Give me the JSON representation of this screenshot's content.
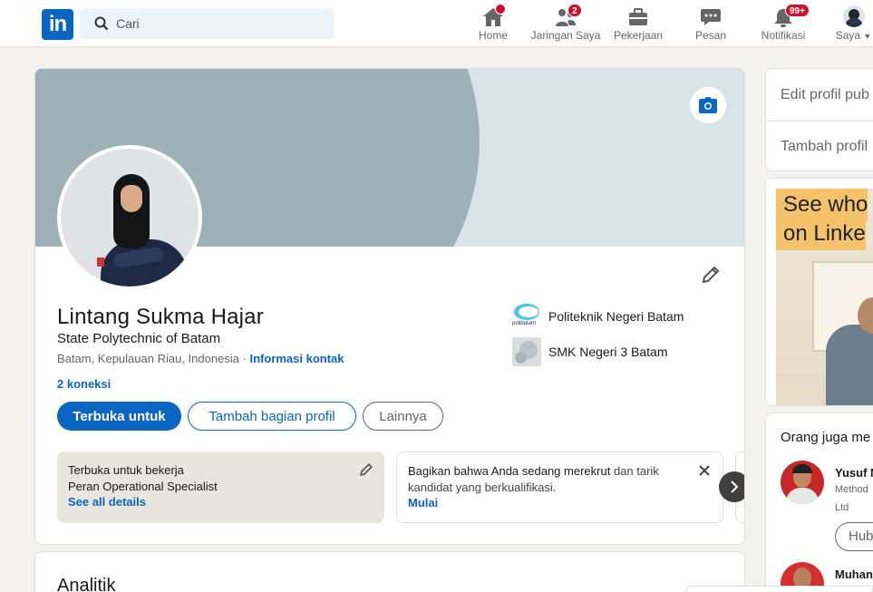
{
  "header": {
    "search_placeholder": "Cari",
    "nav": [
      {
        "label": "Home",
        "badge": ""
      },
      {
        "label": "Jaringan Saya",
        "badge": "2"
      },
      {
        "label": "Pekerjaan",
        "badge": ""
      },
      {
        "label": "Pesan",
        "badge": ""
      },
      {
        "label": "Notifikasi",
        "badge": "99+"
      },
      {
        "label": "Saya",
        "badge": ""
      }
    ]
  },
  "profile": {
    "name": "Lintang Sukma Hajar",
    "headline": "State Polytechnic of Batam",
    "location": "Batam, Kepulauan Riau, Indonesia · ",
    "contact_link": "Informasi kontak",
    "connections": "2 koneksi",
    "education": [
      {
        "name": "Politeknik Negeri Batam",
        "logo_text": "polibatam"
      },
      {
        "name": "SMK Negeri 3 Batam"
      }
    ],
    "buttons": {
      "open_to": "Terbuka untuk",
      "add_section": "Tambah bagian profil",
      "more": "Lainnya"
    },
    "open_to_work": {
      "title": "Terbuka untuk bekerja",
      "role": "Peran Operational Specialist",
      "link": "See all details"
    },
    "hiring": {
      "text_bold": "Bagikan bahwa Anda sedang merekrut",
      "text_rest": " dan tarik kandidat yang berkualifikasi.",
      "link": "Mulai"
    }
  },
  "analytics": {
    "title": "Analitik"
  },
  "sidebar": {
    "edit_public": "Edit profil pub",
    "add_profile": "Tambah profil",
    "ad_line1": "See who",
    "ad_line2": "on Linke",
    "people_title": "Orang juga me",
    "people": [
      {
        "name": "Yusuf N",
        "sub1": "Method",
        "sub2": "Ltd",
        "button": "Hub"
      },
      {
        "name": "Muhan"
      }
    ]
  },
  "colors": {
    "brand": "#0a66c2",
    "notification": "#cb112d"
  }
}
